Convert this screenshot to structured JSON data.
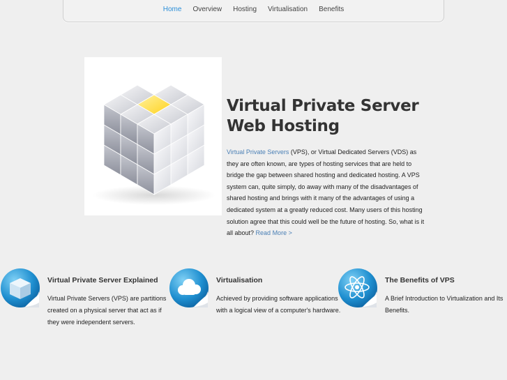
{
  "nav": {
    "items": [
      "Home",
      "Overview",
      "Hosting",
      "Virtualisation",
      "Benefits"
    ],
    "active": "Home"
  },
  "hero": {
    "title_line1": "Virtual Private Server",
    "title_line2": "Web Hosting",
    "link_text": "Virtual Private Servers",
    "body": " (VPS), or Virtual Dedicated Servers (VDS) as they are often known, are types of hosting services that are held to bridge the gap between shared hosting and dedicated hosting. A VPS system can, quite simply, do away with many of the disadvantages of shared hosting and brings with it many of the advantages of using a dedicated system at a greatly reduced cost. Many users of this hosting solution agree that this could well be the future of hosting. So, what is it all about? ",
    "read_more": "Read More >",
    "image_icon": "cube-icon"
  },
  "features": [
    {
      "icon": "box-icon",
      "title": "Virtual Private Server Explained",
      "text": "Virtual Private Servers (VPS) are partitions created on a physical server that act as if they were independent servers."
    },
    {
      "icon": "cloud-icon",
      "title": "Virtualisation",
      "text": "Achieved by providing software applications with a logical view of a computer's hardware."
    },
    {
      "icon": "atom-icon",
      "title": "The Benefits of VPS",
      "text": "A Brief Introduction to Virtualization and Its Benefits."
    }
  ],
  "colors": {
    "accent": "#2a8ed8",
    "link": "#4a7fb5",
    "cube_highlight": "#f5b400",
    "background": "#efefef"
  }
}
